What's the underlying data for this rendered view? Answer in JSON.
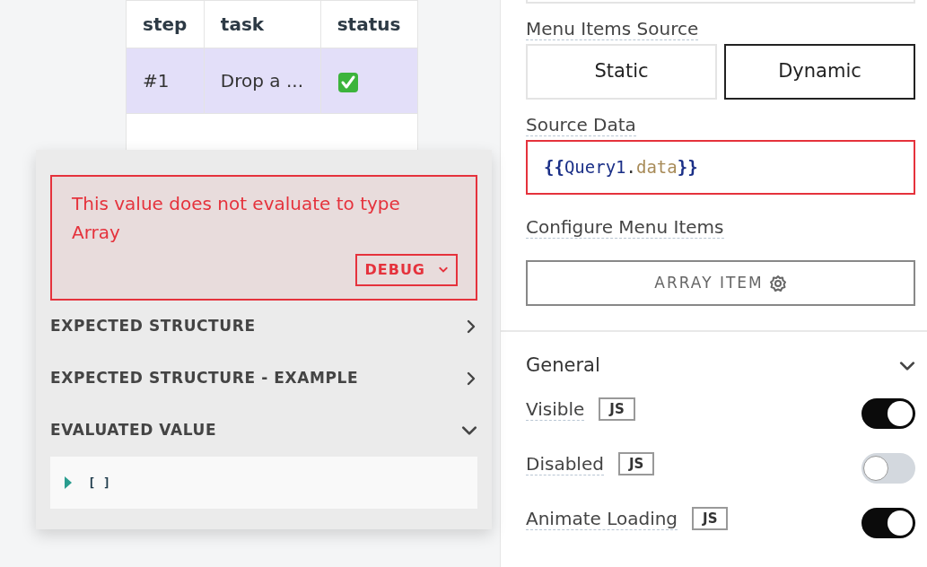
{
  "table": {
    "columns": [
      "step",
      "task",
      "status"
    ],
    "rows": [
      {
        "step": "#1",
        "task": "Drop a ...",
        "status": {
          "kind": "check"
        },
        "selected": true
      }
    ]
  },
  "validation_popup": {
    "error": "This value does not evaluate to type Array",
    "debug_button": "DEBUG",
    "sections": [
      {
        "label": "EXPECTED STRUCTURE",
        "expanded": false
      },
      {
        "label": "EXPECTED STRUCTURE - EXAMPLE",
        "expanded": false
      },
      {
        "label": "EVALUATED VALUE",
        "expanded": true
      }
    ],
    "evaluated_value": "[ ]"
  },
  "properties_panel": {
    "menu_items_source": {
      "label": "Menu Items Source",
      "options": [
        {
          "label": "Static",
          "selected": false
        },
        {
          "label": "Dynamic",
          "selected": true
        }
      ]
    },
    "source_data": {
      "label": "Source Data",
      "invalid": true,
      "tokens": [
        {
          "kind": "brace",
          "text": "{{"
        },
        {
          "kind": "ident",
          "text": "Query1"
        },
        {
          "kind": "punct",
          "text": "."
        },
        {
          "kind": "prop",
          "text": "data"
        },
        {
          "kind": "brace",
          "text": "}}"
        }
      ]
    },
    "configure_label": "Configure Menu Items",
    "array_item_button": "ARRAY ITEM",
    "general": {
      "title": "General",
      "expanded": true,
      "properties": [
        {
          "label": "Visible",
          "badge": "JS",
          "on": true
        },
        {
          "label": "Disabled",
          "badge": "JS",
          "on": false
        },
        {
          "label": "Animate Loading",
          "badge": "JS",
          "on": true
        }
      ]
    }
  }
}
